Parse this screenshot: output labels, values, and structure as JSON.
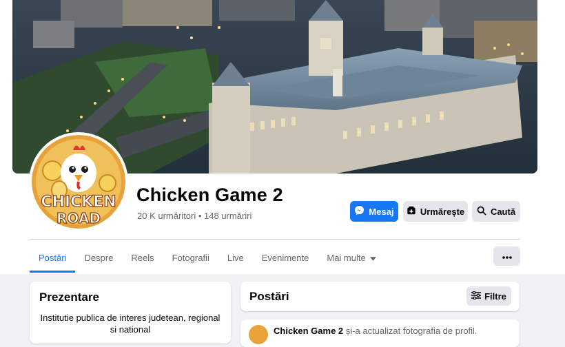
{
  "page": {
    "name": "Chicken Game 2",
    "stats": "20 K urmăritori • 148 urmăriri"
  },
  "avatar": {
    "logo_text_line1": "CHICKEN",
    "logo_text_line2": "ROAD"
  },
  "actions": {
    "message": "Mesaj",
    "follow": "Urmărește",
    "search": "Caută"
  },
  "tabs": [
    "Postări",
    "Despre",
    "Reels",
    "Fotografii",
    "Live",
    "Evenimente",
    "Mai multe"
  ],
  "intro": {
    "title": "Prezentare",
    "description": "Institutie publica de interes judetean, regional si national"
  },
  "posts": {
    "title": "Postări",
    "filters": "Filtre",
    "first_post_author": "Chicken Game 2",
    "first_post_action": "și-a actualizat fotografia de profil."
  },
  "colors": {
    "accent": "#1877f2",
    "background": "#f0f2f5",
    "secondary_button": "#e4e6eb"
  }
}
